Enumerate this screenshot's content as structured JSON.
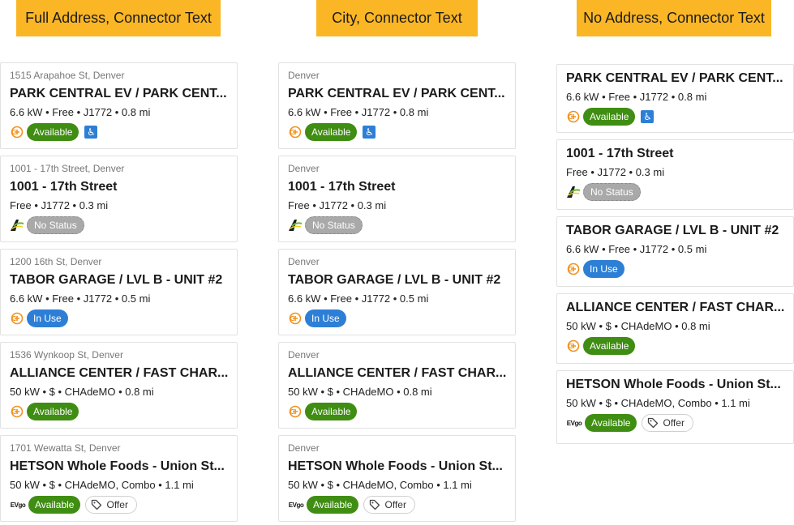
{
  "headers": [
    "Full Address, Connector Text",
    "City, Connector Text",
    "No Address, Connector Text"
  ],
  "columns": [
    {
      "variant": "full",
      "cards": [
        {
          "address": "1515 Arapahoe St, Denver",
          "name": "PARK CENTRAL EV / PARK CENT...",
          "details": "6.6 kW • Free • J1772 • 0.8 mi",
          "network": "charge-icon",
          "status": "Available",
          "status_type": "available",
          "accessible": true,
          "offer": ""
        },
        {
          "address": "1001 - 17th Street, Denver",
          "name": "1001 - 17th Street",
          "details": "Free • J1772 • 0.3 mi",
          "network": "road-icon",
          "status": "No Status",
          "status_type": "nostatus",
          "accessible": false,
          "offer": ""
        },
        {
          "address": "1200 16th St, Denver",
          "name": "TABOR GARAGE / LVL B - UNIT #2",
          "details": "6.6 kW • Free • J1772 • 0.5 mi",
          "network": "charge-icon",
          "status": "In Use",
          "status_type": "inuse",
          "accessible": false,
          "offer": ""
        },
        {
          "address": "1536 Wynkoop St, Denver",
          "name": "ALLIANCE CENTER / FAST CHAR...",
          "details": "50 kW • $ • CHAdeMO • 0.8 mi",
          "network": "charge-icon",
          "status": "Available",
          "status_type": "available",
          "accessible": false,
          "offer": ""
        },
        {
          "address": "1701 Wewatta St, Denver",
          "name": "HETSON Whole Foods - Union St...",
          "details": "50 kW • $ • CHAdeMO, Combo • 1.1 mi",
          "network": "evgo-logo",
          "status": "Available",
          "status_type": "available",
          "accessible": false,
          "offer": "Offer"
        }
      ]
    },
    {
      "variant": "city",
      "cards": [
        {
          "address": "Denver",
          "name": "PARK CENTRAL EV / PARK CENT...",
          "details": "6.6 kW • Free • J1772 • 0.8 mi",
          "network": "charge-icon",
          "status": "Available",
          "status_type": "available",
          "accessible": true,
          "offer": ""
        },
        {
          "address": "Denver",
          "name": "1001 - 17th Street",
          "details": "Free • J1772 • 0.3 mi",
          "network": "road-icon",
          "status": "No Status",
          "status_type": "nostatus",
          "accessible": false,
          "offer": ""
        },
        {
          "address": "Denver",
          "name": "TABOR GARAGE / LVL B - UNIT #2",
          "details": "6.6 kW • Free • J1772 • 0.5 mi",
          "network": "charge-icon",
          "status": "In Use",
          "status_type": "inuse",
          "accessible": false,
          "offer": ""
        },
        {
          "address": "Denver",
          "name": "ALLIANCE CENTER / FAST CHAR...",
          "details": "50 kW • $ • CHAdeMO • 0.8 mi",
          "network": "charge-icon",
          "status": "Available",
          "status_type": "available",
          "accessible": false,
          "offer": ""
        },
        {
          "address": "Denver",
          "name": "HETSON Whole Foods - Union St...",
          "details": "50 kW • $ • CHAdeMO, Combo • 1.1 mi",
          "network": "evgo-logo",
          "status": "Available",
          "status_type": "available",
          "accessible": false,
          "offer": "Offer"
        }
      ]
    },
    {
      "variant": "noaddr",
      "cards": [
        {
          "address": "",
          "name": "PARK CENTRAL EV / PARK CENT...",
          "details": "6.6 kW • Free • J1772 • 0.8 mi",
          "network": "charge-icon",
          "status": "Available",
          "status_type": "available",
          "accessible": true,
          "offer": ""
        },
        {
          "address": "",
          "name": "1001 - 17th Street",
          "details": "Free • J1772 • 0.3 mi",
          "network": "road-icon",
          "status": "No Status",
          "status_type": "nostatus",
          "accessible": false,
          "offer": ""
        },
        {
          "address": "",
          "name": "TABOR GARAGE / LVL B - UNIT #2",
          "details": "6.6 kW • Free • J1772 • 0.5 mi",
          "network": "charge-icon",
          "status": "In Use",
          "status_type": "inuse",
          "accessible": false,
          "offer": ""
        },
        {
          "address": "",
          "name": "ALLIANCE CENTER / FAST CHAR...",
          "details": "50 kW • $ • CHAdeMO • 0.8 mi",
          "network": "charge-icon",
          "status": "Available",
          "status_type": "available",
          "accessible": false,
          "offer": ""
        },
        {
          "address": "",
          "name": "HETSON Whole Foods - Union St...",
          "details": "50 kW • $ • CHAdeMO, Combo • 1.1 mi",
          "network": "evgo-logo",
          "status": "Available",
          "status_type": "available",
          "accessible": false,
          "offer": "Offer"
        }
      ]
    }
  ],
  "network_logo_text": "EVgo",
  "colors": {
    "header": "#fbb626",
    "available": "#3f8d12",
    "inuse": "#2d7fd6",
    "nostatus": "#a9a9a9"
  }
}
